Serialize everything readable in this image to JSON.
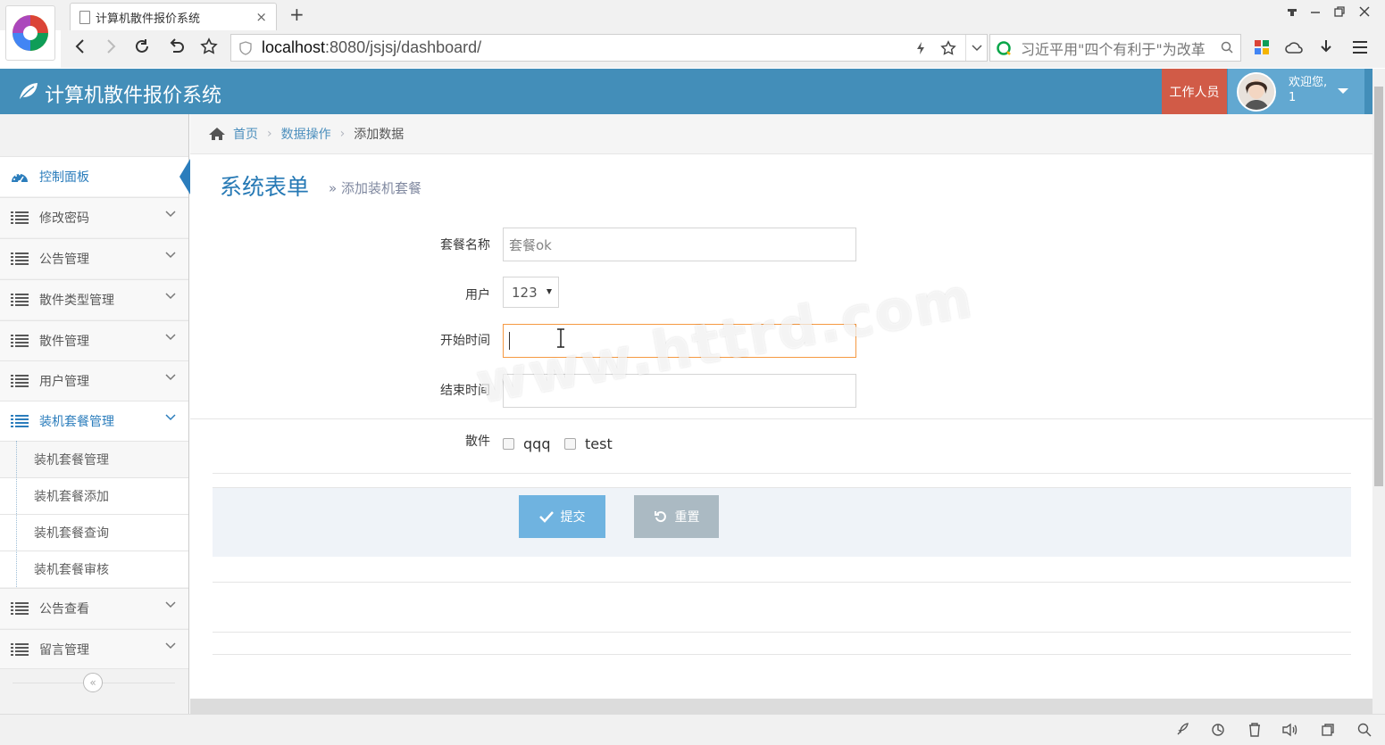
{
  "browser": {
    "tab_title": "计算机散件报价系统",
    "tab_close": "×",
    "new_tab": "+",
    "url_host": "localhost",
    "url_path": ":8080/jsjsj/dashboard/",
    "search_text": "习近平用\"四个有利于\"为改革"
  },
  "app": {
    "title": "计算机散件报价系统",
    "role_label": "工作人员",
    "welcome": "欢迎您,",
    "username": "1"
  },
  "breadcrumb": {
    "home": "首页",
    "level1": "数据操作",
    "current": "添加数据"
  },
  "sidebar": {
    "items": [
      {
        "label": "控制面板"
      },
      {
        "label": "修改密码"
      },
      {
        "label": "公告管理"
      },
      {
        "label": "散件类型管理"
      },
      {
        "label": "散件管理"
      },
      {
        "label": "用户管理"
      },
      {
        "label": "装机套餐管理"
      },
      {
        "label": "公告查看"
      },
      {
        "label": "留言管理"
      }
    ],
    "subitems": [
      {
        "label": "装机套餐管理"
      },
      {
        "label": "装机套餐添加"
      },
      {
        "label": "装机套餐查询"
      },
      {
        "label": "装机套餐审核"
      }
    ],
    "collapse_glyph": "«"
  },
  "page": {
    "title": "系统表单",
    "subtitle": "» 添加装机套餐"
  },
  "form": {
    "name_label": "套餐名称",
    "name_placeholder": "套餐ok",
    "user_label": "用户",
    "user_value": "123",
    "start_label": "开始时间",
    "end_label": "结束时间",
    "parts_label": "散件",
    "parts": [
      "qqq",
      "test"
    ],
    "submit_label": "提交",
    "reset_label": "重置"
  },
  "watermark": "www.httrd.com",
  "colors": {
    "header": "#438eb9",
    "role_btn": "#d15b47",
    "submit": "#6fb3e0",
    "reset": "#abbac3",
    "focus": "#f59942"
  }
}
